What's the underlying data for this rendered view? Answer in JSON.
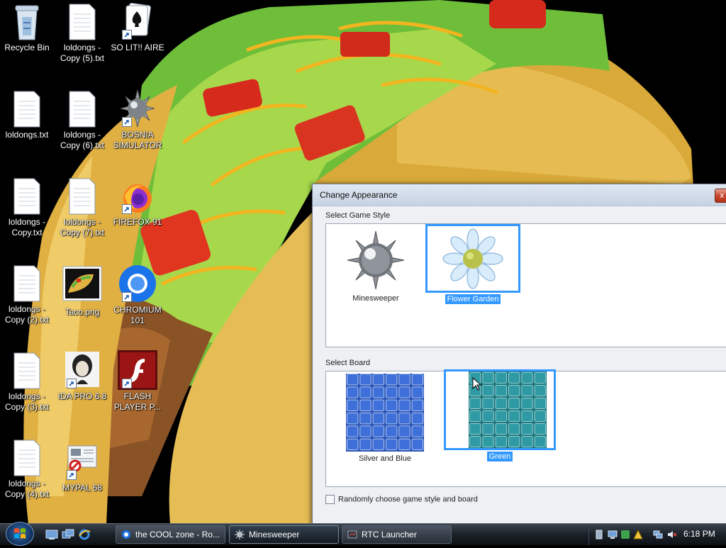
{
  "desktop": {
    "icons": [
      {
        "label": "Recycle Bin",
        "icon": "recycle-bin-icon"
      },
      {
        "label": "loldongs - Copy (5).txt",
        "icon": "text-file-icon"
      },
      {
        "label": "SO LIT!! AIRE",
        "icon": "cards-icon"
      },
      {
        "label": "loldongs.txt",
        "icon": "text-file-icon"
      },
      {
        "label": "loldongs - Copy (6).txt",
        "icon": "text-file-icon"
      },
      {
        "label": "BOSNIA SIMULATOR",
        "icon": "mine-icon"
      },
      {
        "label": "loldongs - Copy.txt",
        "icon": "text-file-icon"
      },
      {
        "label": "loldongs - Copy (7).txt",
        "icon": "text-file-icon"
      },
      {
        "label": "FIREFOX 91",
        "icon": "firefox-icon"
      },
      {
        "label": "loldongs - Copy (2).txt",
        "icon": "text-file-icon"
      },
      {
        "label": "Taco.png",
        "icon": "image-file-icon"
      },
      {
        "label": "CHROMIUM 101",
        "icon": "chromium-icon"
      },
      {
        "label": "loldongs - Copy (3).txt",
        "icon": "text-file-icon"
      },
      {
        "label": "IDA PRO 6.8",
        "icon": "ida-icon"
      },
      {
        "label": "FLASH PLAYER P...",
        "icon": "flash-icon"
      },
      {
        "label": "loldongs - Copy (4).txt",
        "icon": "text-file-icon"
      },
      {
        "label": "MYPAL 68",
        "icon": "mypal-icon"
      }
    ]
  },
  "dialog": {
    "title": "Change Appearance",
    "close": "x",
    "game_style_label": "Select Game Style",
    "game_styles": [
      {
        "label": "Minesweeper",
        "selected": false
      },
      {
        "label": "Flower Garden",
        "selected": true
      }
    ],
    "board_label": "Select Board",
    "boards": [
      {
        "label": "Silver and Blue",
        "selected": false,
        "color": "#3f6fd9"
      },
      {
        "label": "Green",
        "selected": true,
        "color": "#2f9aa3"
      }
    ],
    "random_checkbox": {
      "label": "Randomly choose game style and board",
      "checked": false
    }
  },
  "taskbar": {
    "tasks": [
      {
        "label": "the COOL zone - Ro...",
        "icon": "chromium-icon",
        "active": false
      },
      {
        "label": "Minesweeper",
        "icon": "mine-icon",
        "active": true
      },
      {
        "label": "RTC Launcher",
        "icon": "rtc-icon",
        "active": false
      }
    ],
    "clock": "6:18 PM"
  },
  "colors": {
    "selection": "#3399ff",
    "taskbar": "#1b2128"
  }
}
